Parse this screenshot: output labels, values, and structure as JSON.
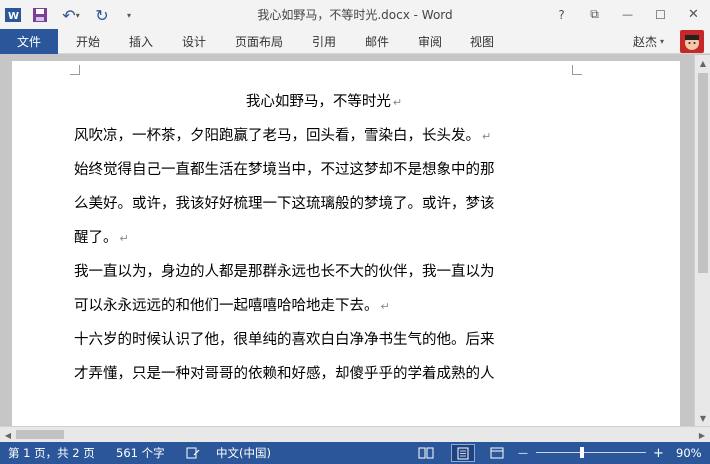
{
  "window": {
    "title": "我心如野马，不等时光.docx - Word",
    "controls": [
      "?",
      "⧉",
      "—",
      "☐",
      "✕"
    ]
  },
  "qat": {
    "undo_glyph": "↶",
    "redo_glyph": "↻",
    "more_glyph": "▾"
  },
  "ribbon": {
    "file_tab": "文件",
    "tabs": [
      "开始",
      "插入",
      "设计",
      "页面布局",
      "引用",
      "邮件",
      "审阅",
      "视图"
    ],
    "user_name": "赵杰",
    "user_caret": "▾"
  },
  "document": {
    "lines": [
      "我心如野马，不等时光",
      "风吹凉，一杯茶，夕阳跑赢了老马，回头看，雪染白，长头发。",
      "始终觉得自己一直都生活在梦境当中，不过这梦却不是想象中的那",
      "么美好。或许，我该好好梳理一下这琉璃般的梦境了。或许，梦该",
      "醒了。",
      "我一直以为，身边的人都是那群永远也长不大的伙伴，我一直以为",
      "可以永永远远的和他们一起嘻嘻哈哈地走下去。",
      "十六岁的时候认识了他，很单纯的喜欢白白净净书生气的他。后来",
      "才弄懂，只是一种对哥哥的依赖和好感，却傻乎乎的学着成熟的人"
    ],
    "paragraph_mark": "↵"
  },
  "status": {
    "page": "第 1 页，共 2 页",
    "words": "561 个字",
    "language": "中文(中国)",
    "zoom_minus": "—",
    "zoom_plus": "+",
    "zoom": "90%"
  },
  "colors": {
    "accent": "#2b579a",
    "title_bg": "#f3f3f3",
    "canvas_bg": "#c6c6c6"
  }
}
